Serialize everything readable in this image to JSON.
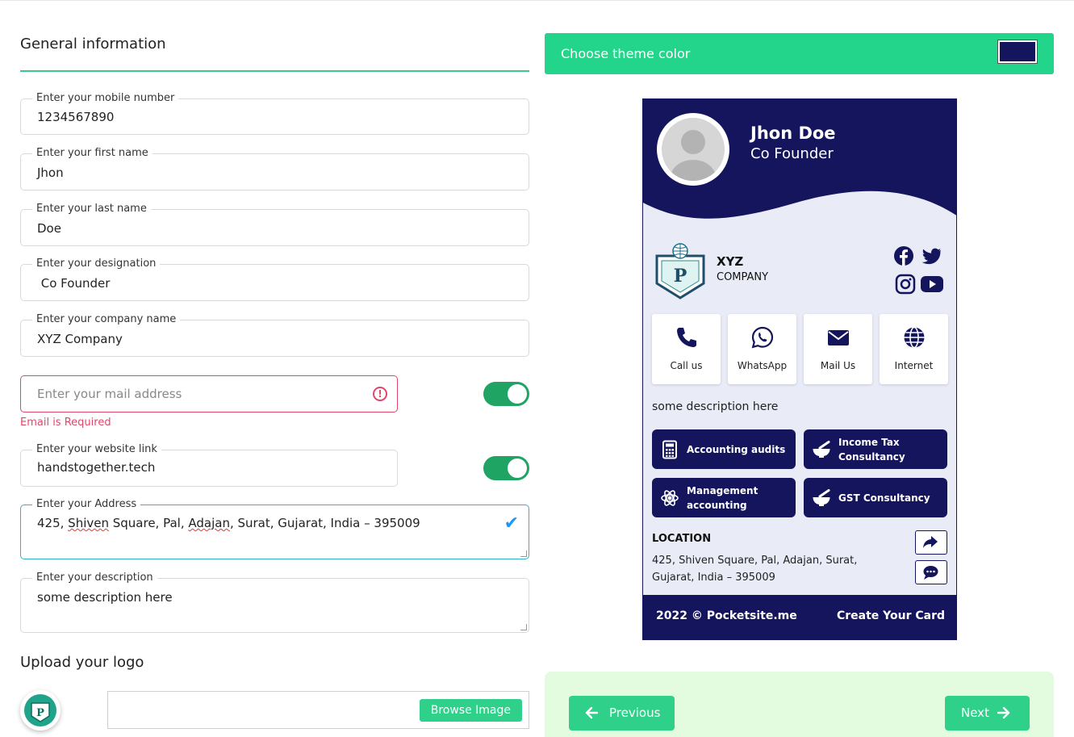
{
  "form": {
    "section_title": "General information",
    "fields": {
      "mobile": {
        "label": "Enter your mobile number",
        "value": "1234567890"
      },
      "first_name": {
        "label": "Enter your first name",
        "value": "Jhon"
      },
      "last_name": {
        "label": "Enter your last name",
        "value": "Doe"
      },
      "designation": {
        "label": "Enter your designation",
        "value": " Co Founder"
      },
      "company": {
        "label": "Enter your company name",
        "value": "XYZ Company"
      },
      "email": {
        "placeholder": "Enter your mail address",
        "error": "Email is Required",
        "toggle_on": true
      },
      "website": {
        "label": "Enter your website link",
        "value": "handstogether.tech",
        "toggle_on": true
      },
      "address": {
        "label": "Enter your Address",
        "value_parts": [
          "425, ",
          "Shiven",
          " Square, Pal, ",
          "Adajan",
          ", Surat, Gujarat, India – 395009"
        ]
      },
      "description": {
        "label": "Enter your description",
        "value": "some description here"
      }
    },
    "upload_title": "Upload your logo",
    "browse_label": "Browse Image"
  },
  "theme": {
    "label": "Choose theme color",
    "color": "#15155e"
  },
  "card": {
    "name": "Jhon Doe",
    "designation": "Co Founder",
    "company_name": "XYZ",
    "company_sub": "COMPANY",
    "social": [
      "facebook-icon",
      "twitter-icon",
      "instagram-icon",
      "youtube-icon"
    ],
    "actions": [
      {
        "label": "Call us",
        "icon": "phone-icon"
      },
      {
        "label": "WhatsApp",
        "icon": "whatsapp-icon"
      },
      {
        "label": "Mail Us",
        "icon": "mail-icon"
      },
      {
        "label": "Internet",
        "icon": "globe-icon"
      }
    ],
    "description": "some description here",
    "services": [
      {
        "label": "Accounting audits",
        "icon": "calculator-icon"
      },
      {
        "label": "Income Tax Consultancy",
        "icon": "mortar-pestle-icon"
      },
      {
        "label": "Management accounting",
        "icon": "atom-gear-icon"
      },
      {
        "label": "GST Consultancy",
        "icon": "mortar-pestle-icon"
      }
    ],
    "location_title": "LOCATION",
    "location_text": "425, Shiven Square, Pal, Adajan, Surat, Gujarat, India – 395009",
    "footer_left": "2022 © Pocketsite.me",
    "footer_right": "Create Your Card"
  },
  "nav": {
    "previous": "Previous",
    "next": "Next"
  }
}
